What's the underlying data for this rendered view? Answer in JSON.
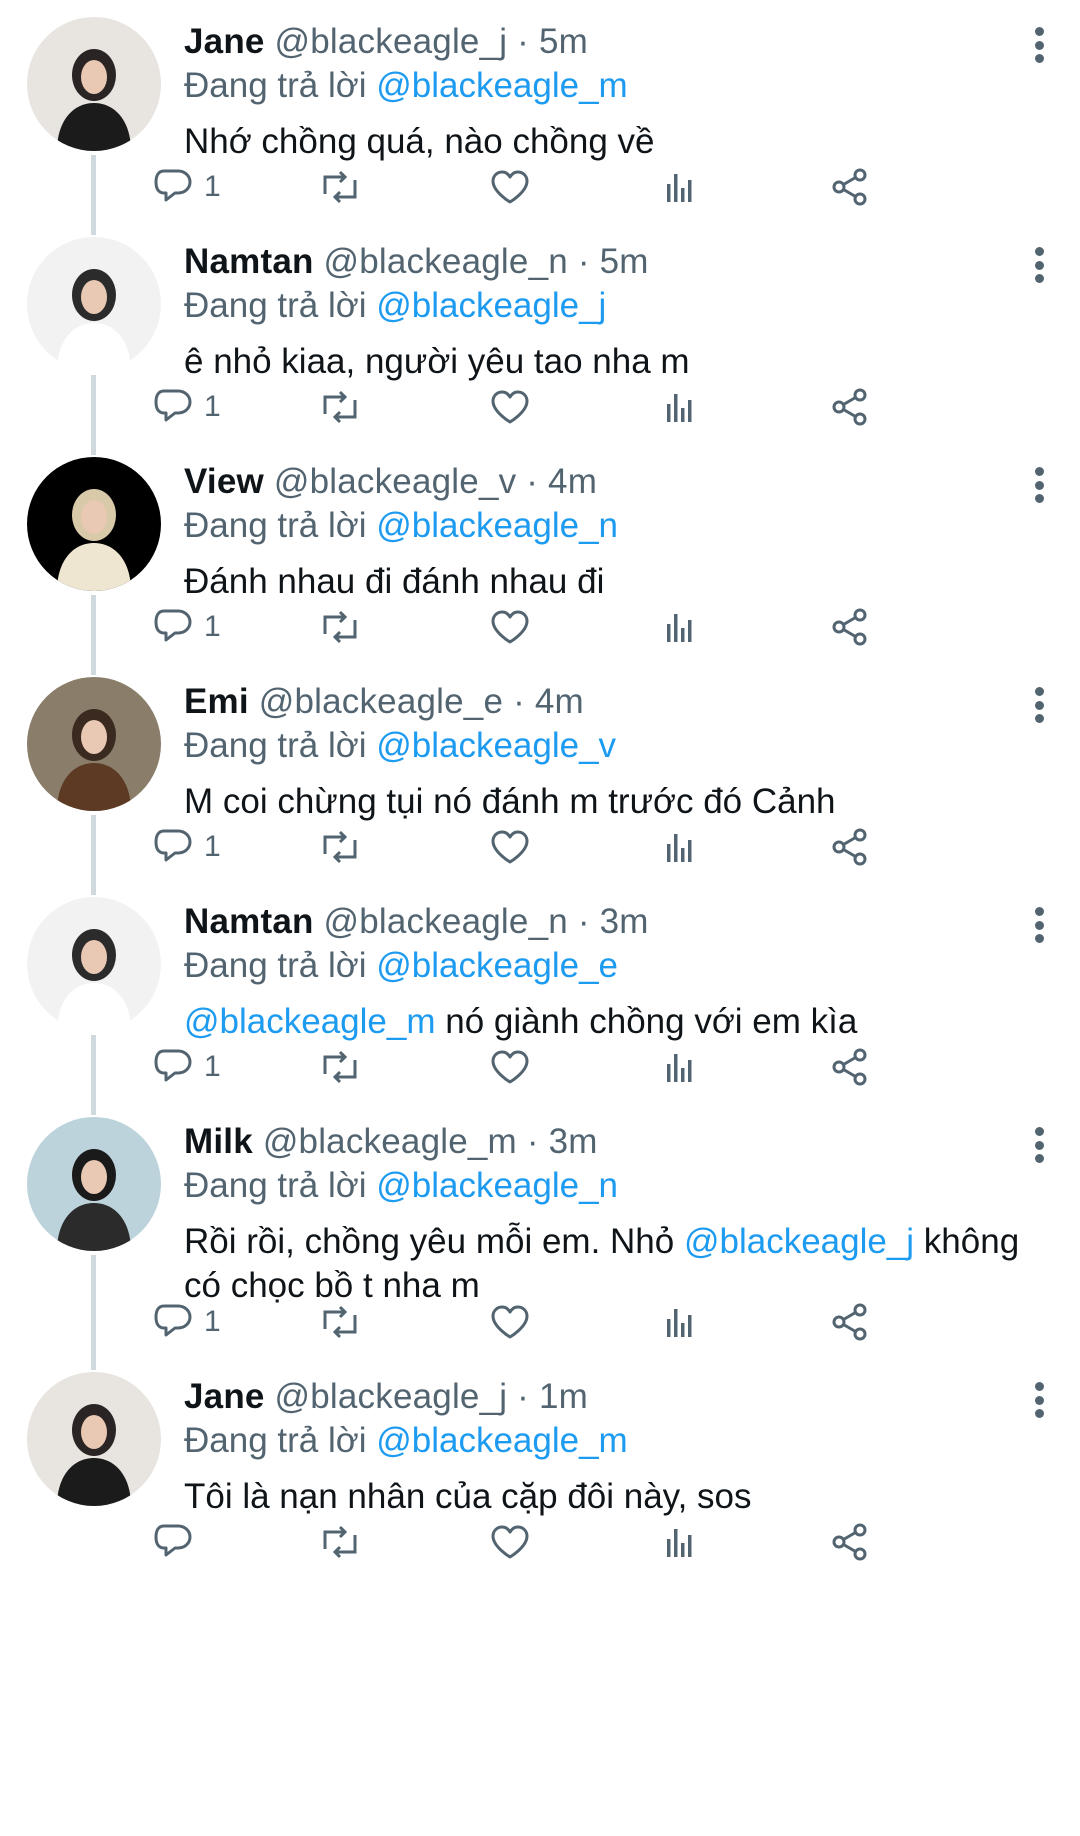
{
  "reply_prefix": "Đang trả lời",
  "tweets": [
    {
      "name": "Jane",
      "handle": "@blackeagle_j",
      "time": "5m",
      "reply_to": "@blackeagle_m",
      "text": [
        {
          "t": "Nhớ chồng quá, nào chồng về",
          "m": false
        }
      ],
      "reply_count": "1"
    },
    {
      "name": "Namtan",
      "handle": "@blackeagle_n",
      "time": "5m",
      "reply_to": "@blackeagle_j",
      "text": [
        {
          "t": "ê nhỏ kiaa, người yêu tao nha m",
          "m": false
        }
      ],
      "reply_count": "1"
    },
    {
      "name": "View",
      "handle": "@blackeagle_v",
      "time": "4m",
      "reply_to": "@blackeagle_n",
      "text": [
        {
          "t": "Đánh nhau đi đánh nhau đi",
          "m": false
        }
      ],
      "reply_count": "1"
    },
    {
      "name": "Emi",
      "handle": "@blackeagle_e",
      "time": "4m",
      "reply_to": "@blackeagle_v",
      "text": [
        {
          "t": "M coi chừng tụi nó đánh m trước đó Cảnh",
          "m": false
        }
      ],
      "reply_count": "1"
    },
    {
      "name": "Namtan",
      "handle": "@blackeagle_n",
      "time": "3m",
      "reply_to": "@blackeagle_e",
      "text": [
        {
          "t": "@blackeagle_m",
          "m": true
        },
        {
          "t": " nó giành chồng với em kìa",
          "m": false
        }
      ],
      "reply_count": "1"
    },
    {
      "name": "Milk",
      "handle": "@blackeagle_m",
      "time": "3m",
      "reply_to": "@blackeagle_n",
      "text": [
        {
          "t": "Rồi rồi, chồng yêu mỗi em. Nhỏ ",
          "m": false
        },
        {
          "t": "@blackeagle_j",
          "m": true
        },
        {
          "t": " không có chọc bồ t nha m",
          "m": false
        }
      ],
      "reply_count": "1"
    },
    {
      "name": "Jane",
      "handle": "@blackeagle_j",
      "time": "1m",
      "reply_to": "@blackeagle_m",
      "text": [
        {
          "t": "Tôi là nạn nhân của cặp đôi này, sos",
          "m": false
        }
      ],
      "reply_count": ""
    }
  ],
  "icons": {
    "reply": "reply-icon",
    "retweet": "retweet-icon",
    "like": "heart-icon",
    "views": "views-icon",
    "share": "share-icon",
    "more": "more-icon"
  },
  "colors": {
    "mention": "#1d9bf0",
    "secondary": "#536471",
    "text": "#0f1419",
    "thread_line": "#cfd9de"
  }
}
